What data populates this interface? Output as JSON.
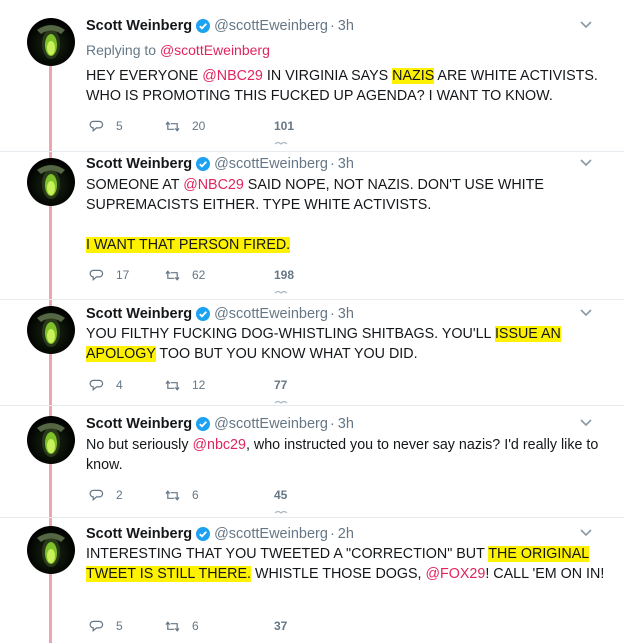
{
  "author": {
    "name": "Scott Weinberg",
    "handle": "@scottEweinberg",
    "dot": "·"
  },
  "tweets": [
    {
      "time": "3h",
      "replying_prefix": "Replying to ",
      "replying_handle": "@scottEweinberg",
      "segments": [
        {
          "t": "HEY EVERYONE ",
          "s": "n"
        },
        {
          "t": "@NBC29",
          "s": "m"
        },
        {
          "t": " IN VIRGINIA SAYS ",
          "s": "n"
        },
        {
          "t": "NAZIS",
          "s": "h"
        },
        {
          "t": " ARE WHITE ACTIVISTS. WHO IS PROMOTING THIS FUCKED UP AGENDA? I WANT TO KNOW.",
          "s": "n"
        }
      ],
      "replies": "5",
      "retweets": "20",
      "likes": "101"
    },
    {
      "time": "3h",
      "segments": [
        {
          "t": "SOMEONE AT ",
          "s": "n"
        },
        {
          "t": "@NBC29",
          "s": "m"
        },
        {
          "t": " SAID NOPE, NOT NAZIS. DON'T USE WHITE SUPREMACISTS EITHER. TYPE WHITE ACTIVISTS.",
          "s": "n"
        },
        {
          "t": "",
          "s": "br"
        },
        {
          "t": "",
          "s": "br"
        },
        {
          "t": "I WANT THAT PERSON FIRED.",
          "s": "h"
        }
      ],
      "replies": "17",
      "retweets": "62",
      "likes": "198"
    },
    {
      "time": "3h",
      "segments": [
        {
          "t": "YOU FILTHY FUCKING DOG-WHISTLING SHITBAGS. YOU'LL ",
          "s": "n"
        },
        {
          "t": "ISSUE AN APOLOGY",
          "s": "h"
        },
        {
          "t": " TOO BUT YOU KNOW WHAT YOU DID.",
          "s": "n"
        }
      ],
      "replies": "4",
      "retweets": "12",
      "likes": "77"
    },
    {
      "time": "3h",
      "segments": [
        {
          "t": "No but seriously ",
          "s": "n"
        },
        {
          "t": "@nbc29",
          "s": "m"
        },
        {
          "t": ", who instructed you to never say nazis? I'd really like to know.",
          "s": "n"
        }
      ],
      "replies": "2",
      "retweets": "6",
      "likes": "45"
    },
    {
      "time": "2h",
      "segments": [
        {
          "t": "INTERESTING THAT YOU TWEETED A \"CORRECTION\" BUT ",
          "s": "n"
        },
        {
          "t": "THE ORIGINAL TWEET IS STILL THERE.",
          "s": "h"
        },
        {
          "t": " WHISTLE THOSE DOGS, ",
          "s": "n"
        },
        {
          "t": "@FOX29",
          "s": "m"
        },
        {
          "t": "! CALL 'EM ON IN!",
          "s": "n"
        }
      ],
      "replies": "5",
      "retweets": "6",
      "likes": "37"
    }
  ],
  "icons": {
    "reply": "reply-icon",
    "retweet": "retweet-icon",
    "like": "like-icon",
    "verified": "verified-badge-icon",
    "caret": "chevron-down-icon"
  },
  "colors": {
    "mention": "#e0245e",
    "highlight": "#fff200",
    "thread_line": "#eda6ad",
    "verified": "#1da1f2",
    "secondary_text": "#657786"
  }
}
